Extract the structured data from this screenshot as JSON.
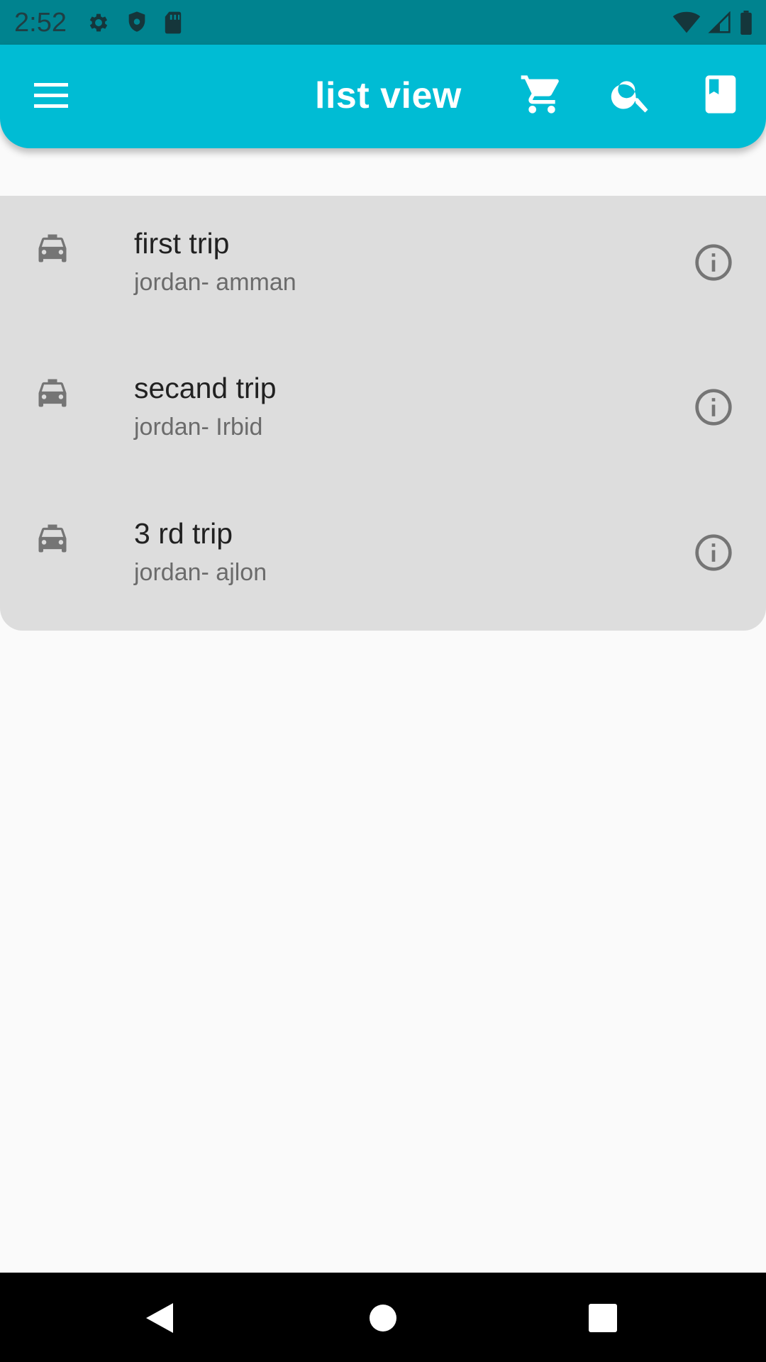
{
  "status_bar": {
    "time": "2:52",
    "icons_left": [
      "settings-icon",
      "shield-icon",
      "sd-card-icon"
    ],
    "icons_right": [
      "wifi-icon",
      "signal-icon",
      "battery-icon"
    ]
  },
  "app_bar": {
    "title": "list view",
    "background_color": "#00bcd4",
    "actions": [
      "menu-icon",
      "cart-icon",
      "search-icon",
      "book-icon"
    ]
  },
  "trips": [
    {
      "title": "first trip",
      "subtitle": "jordan- amman",
      "icon": "taxi-icon",
      "action_icon": "info-icon"
    },
    {
      "title": "secand trip",
      "subtitle": "jordan- Irbid",
      "icon": "taxi-icon",
      "action_icon": "info-icon"
    },
    {
      "title": "3 rd trip",
      "subtitle": "jordan- ajlon",
      "icon": "taxi-icon",
      "action_icon": "info-icon"
    }
  ],
  "colors": {
    "status_bar": "#00838f",
    "list_background": "#dddddd",
    "page_background": "#fafafa"
  },
  "nav_bar": {
    "buttons": [
      "back-icon",
      "home-icon",
      "recents-icon"
    ]
  }
}
